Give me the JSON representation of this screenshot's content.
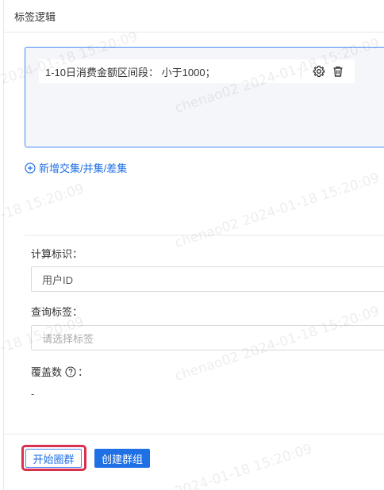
{
  "section_title": "标签逻辑",
  "rule": {
    "text": "1-10日消费金额区间段：  小于1000；",
    "settings_icon": "gear-icon",
    "delete_icon": "trash-icon"
  },
  "add_link": {
    "label": "新增交集/并集/差集",
    "icon": "plus-circle-icon"
  },
  "calc_id": {
    "label": "计算标识：",
    "value": "用户ID"
  },
  "query_tag": {
    "label": "查询标签：",
    "placeholder": "请选择标签"
  },
  "coverage": {
    "label": "覆盖数",
    "value": "-",
    "icon": "question-circle-icon"
  },
  "buttons": {
    "start_label": "开始圈群",
    "create_label": "创建群组"
  },
  "watermark": {
    "text_full": "chenao02 2024-01-18 15:20:09",
    "text_date": "2024-01-18 15:20:09",
    "text_time_tail": "-18 15:20:09"
  },
  "colors": {
    "accent": "#1f6fe5",
    "highlight": "#d9304e",
    "box_bg": "#f4f6f9"
  }
}
